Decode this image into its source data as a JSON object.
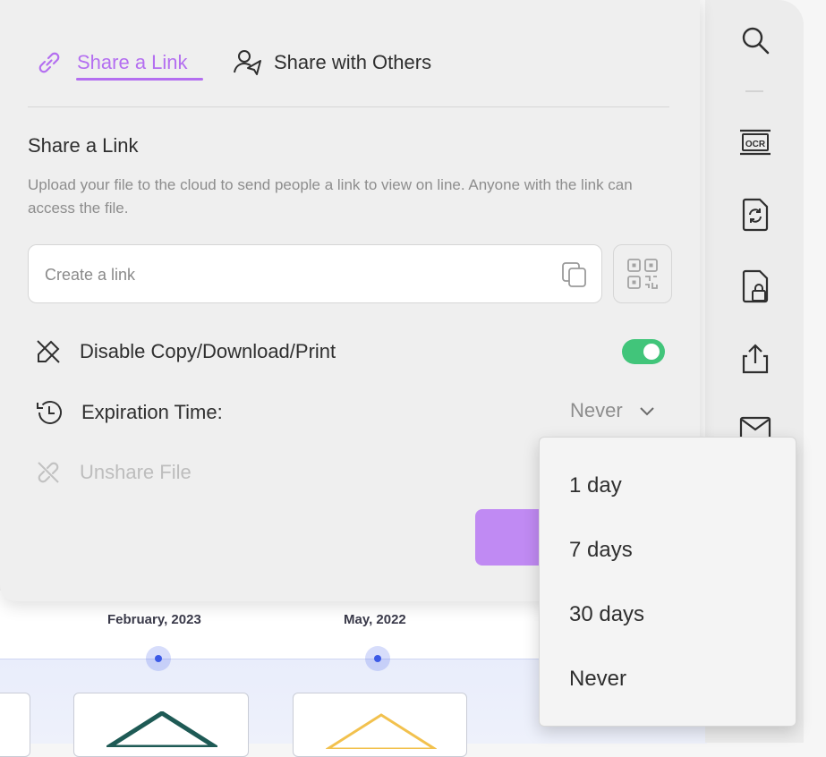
{
  "tabs": [
    {
      "label": "Share a Link",
      "icon": "link-icon",
      "active": true
    },
    {
      "label": "Share with Others",
      "icon": "user-share-icon",
      "active": false
    }
  ],
  "share_link": {
    "title": "Share a Link",
    "description": "Upload your file to the cloud to send people a link to view on line. Anyone with the link can access the file.",
    "link_placeholder": "Create a link",
    "link_value": ""
  },
  "options": {
    "disable_label": "Disable Copy/Download/Print",
    "disable_enabled": true,
    "expiration_label": "Expiration Time:",
    "expiration_value": "Never",
    "unshare_label": "Unshare File"
  },
  "dropdown": {
    "items": [
      "1 day",
      "7 days",
      "30 days",
      "Never"
    ]
  },
  "background_doc": {
    "dates": [
      "February, 2023",
      "May, 2022"
    ]
  },
  "sidebar": {
    "icons": [
      "search-icon",
      "ocr-icon",
      "convert-icon",
      "protect-icon",
      "share-icon",
      "mail-icon"
    ],
    "ocr_text": "OCR"
  },
  "colors": {
    "accent": "#b46ff0",
    "toggle_on": "#41c57a",
    "primary_button": "#c08af3"
  }
}
